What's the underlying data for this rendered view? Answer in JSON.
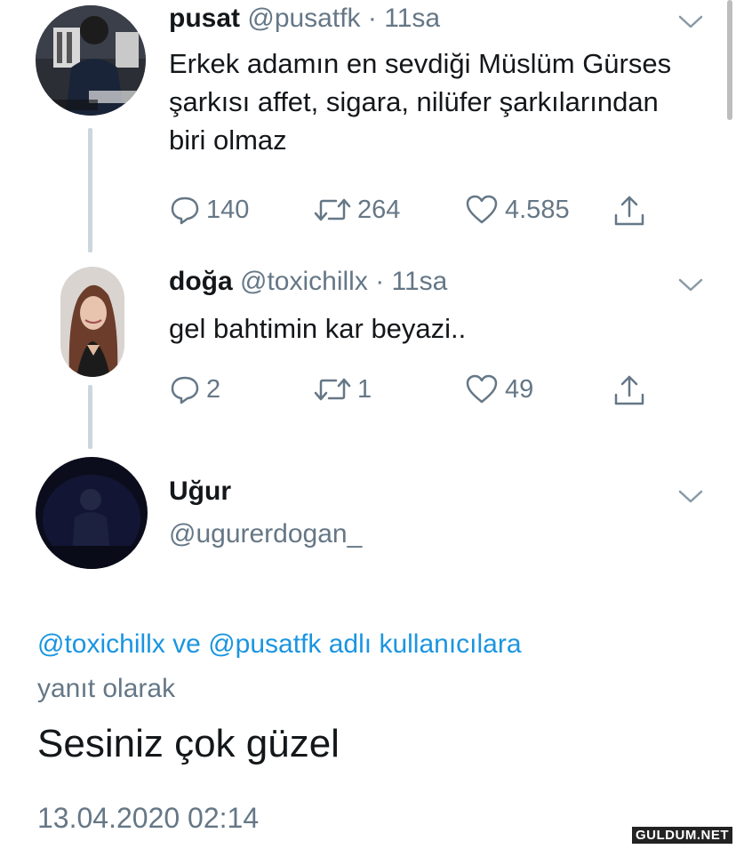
{
  "tweets": [
    {
      "name": "pusat",
      "handle": "@pusatfk",
      "separator": "·",
      "time": "11sa",
      "text": "Erkek adamın en sevdiği Müslüm Gürses şarkısı affet, sigara, nilüfer şarkılarından biri olmaz",
      "replies": "140",
      "retweets": "264",
      "likes": "4.585"
    },
    {
      "name": "doğa",
      "handle": "@toxichillx",
      "separator": "·",
      "time": "11sa",
      "text": "gel bahtimin kar beyazi..",
      "replies": "2",
      "retweets": "1",
      "likes": "49"
    }
  ],
  "main_tweet": {
    "name": "Uğur",
    "handle": "@ugurerdogan_",
    "reply_to": {
      "mention1": "@toxichillx",
      "connector": "ve",
      "mention2": "@pusatfk",
      "suffix": "adlı kullanıcılara yanıt olarak"
    },
    "text": "Sesiniz çok güzel",
    "timestamp": "13.04.2020 02:14"
  },
  "watermark": "GULDUM.NET",
  "icons": {
    "reply": "reply-icon",
    "retweet": "retweet-icon",
    "like": "heart-icon",
    "share": "share-icon",
    "menu": "chevron-down-icon"
  },
  "colors": {
    "text": "#14171a",
    "secondary": "#657786",
    "link": "#1b95e0",
    "thread_line": "#ccd6dd"
  }
}
